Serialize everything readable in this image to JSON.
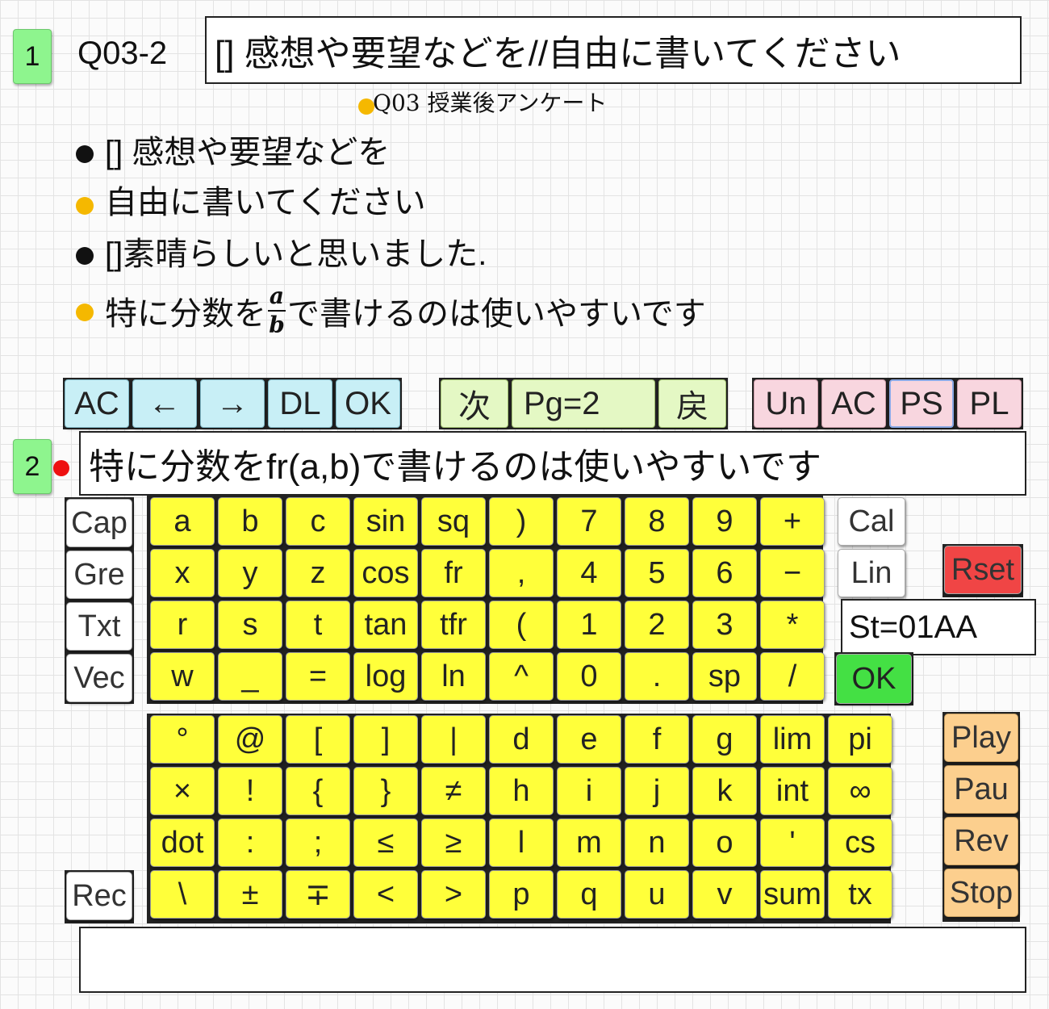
{
  "q1": {
    "number": "1",
    "label": "Q03-2",
    "title": "[] 感想や要望などを//自由に書いてください",
    "subtitle": "Q03 授業後アンケート",
    "lines": [
      "[] 感想や要望などを",
      "自由に書いてください",
      "[]素晴らしいと思いました."
    ],
    "line4_before": "特に分数を",
    "line4_frac_num": "a",
    "line4_frac_den": "b",
    "line4_after": "で書けるのは使いやすいです"
  },
  "toolbar": {
    "ac": "AC",
    "left": "←",
    "right": "→",
    "dl": "DL",
    "ok": "OK",
    "next": "次",
    "page": "Pg=2",
    "back": "戻",
    "undo": "Un",
    "ac2": "AC",
    "ps": "PS",
    "pl": "PL"
  },
  "q2": {
    "number": "2",
    "input_value": "特に分数をfr(a,b)で書けるのは使いやすいです"
  },
  "left_keys": [
    "Cap",
    "Gre",
    "Txt",
    "Vec",
    "Rec"
  ],
  "keypad1": [
    [
      "a",
      "b",
      "c",
      "sin",
      "sq",
      ")",
      "7",
      "8",
      "9",
      "+"
    ],
    [
      "x",
      "y",
      "z",
      "cos",
      "fr",
      ",",
      "4",
      "5",
      "6",
      "−"
    ],
    [
      "r",
      "s",
      "t",
      "tan",
      "tfr",
      "(",
      "1",
      "2",
      "3",
      "*"
    ],
    [
      "w",
      "_",
      "=",
      "log",
      "ln",
      "^",
      "0",
      ".",
      "sp",
      "/"
    ]
  ],
  "keypad2": [
    [
      "°",
      "@",
      "[",
      "]",
      "|",
      "d",
      "e",
      "f",
      "g",
      "lim",
      "pi"
    ],
    [
      "×",
      "!",
      "{",
      "}",
      "≠",
      "h",
      "i",
      "j",
      "k",
      "int",
      "∞"
    ],
    [
      "dot",
      ":",
      ";",
      "≤",
      "≥",
      "l",
      "m",
      "n",
      "o",
      "'",
      "cs"
    ],
    [
      "\\",
      "±",
      "∓",
      "<",
      ">",
      "p",
      "q",
      "u",
      "v",
      "sum",
      "tx"
    ]
  ],
  "right_keys": {
    "cal": "Cal",
    "lin": "Lin",
    "reset": "Rset",
    "status": "St=01AA",
    "ok": "OK"
  },
  "media_keys": [
    "Play",
    "Pau",
    "Rev",
    "Stop"
  ],
  "bottom_input": {
    "value": ""
  },
  "colors": {
    "yellow_key": "#ffff3a",
    "reset": "#f04545",
    "ok_green": "#44e044",
    "orange_key": "#fccf8e"
  }
}
